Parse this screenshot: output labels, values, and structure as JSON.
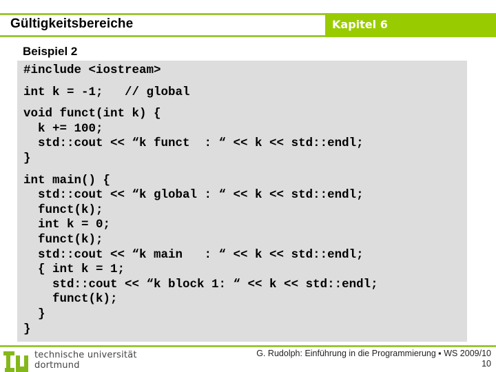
{
  "header": {
    "title": "Gültigkeitsbereiche",
    "chapter": "Kapitel 6",
    "accent_color": "#99cc00"
  },
  "slide": {
    "subtitle": "Beispiel 2",
    "code_lines": [
      "#include <iostream>",
      "",
      "int k = -1;   // global",
      "",
      "void funct(int k) {",
      "  k += 100;",
      "  std::cout << “k funct  : “ << k << std::endl;",
      "}",
      "",
      "int main() {",
      "  std::cout << “k global : “ << k << std::endl;",
      "  funct(k);",
      "  int k = 0;",
      "  funct(k);",
      "  std::cout << “k main   : “ << k << std::endl;",
      "  { int k = 1;",
      "    std::cout << “k block 1: “ << k << std::endl;",
      "    funct(k);",
      "  }",
      "}"
    ]
  },
  "footer": {
    "logo_icon": "tu-logo-icon",
    "university_line1": "technische universität",
    "university_line2": "dortmund",
    "credit": "G. Rudolph: Einführung in die Programmierung ▪ WS 2009/10",
    "page_number": "10"
  }
}
